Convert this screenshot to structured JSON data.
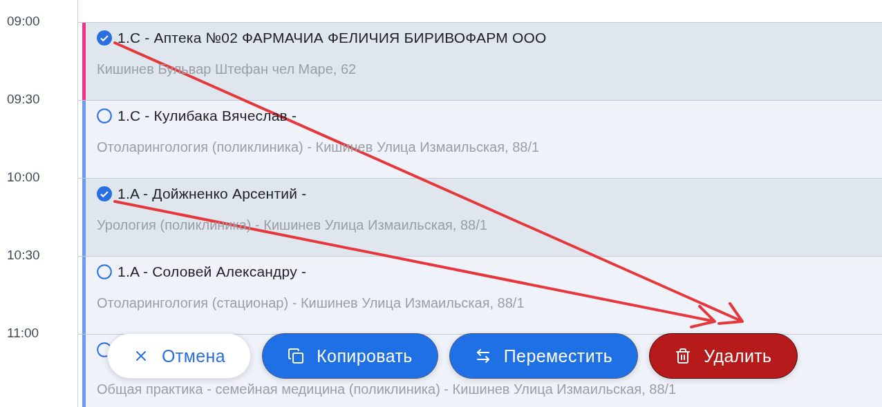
{
  "time_labels": [
    "09:00",
    "09:30",
    "10:00",
    "10:30",
    "11:00"
  ],
  "events": [
    {
      "title": "1.C - Аптека №02 ФАРМАЧИА ФЕЛИЧИЯ БИРИВОФАРМ ООО",
      "subtitle": "Кишинев Бульвар Штефан чел Маре, 62",
      "selected": true,
      "color": "#f0348c"
    },
    {
      "title": "1.C - Кулибака Вячеслав -",
      "subtitle": "Отоларингология (поликлиника) - Кишинев Улица Измаильская, 88/1",
      "selected": false,
      "color": "#6a9af5"
    },
    {
      "title": "1.A - Дойжненко Арсентий -",
      "subtitle": "Урология (поликлиника) - Кишинев Улица Измаильская, 88/1",
      "selected": true,
      "color": "#6a9af5"
    },
    {
      "title": "1.A - Соловей Александру -",
      "subtitle": "Отоларингология (стационар) - Кишинев Улица Измаильская, 88/1",
      "selected": false,
      "color": "#6a9af5"
    },
    {
      "subtitle": "Общая практика - семейная медицина (поликлиника) - Кишинев Улица Измаильская, 88/1",
      "selected": false,
      "color": "#6a9af5"
    }
  ],
  "actions": [
    {
      "kind": "cancel",
      "label": "Отмена"
    },
    {
      "kind": "copy",
      "label": "Копировать"
    },
    {
      "kind": "move",
      "label": "Переместить"
    },
    {
      "kind": "delete",
      "label": "Удалить"
    }
  ]
}
